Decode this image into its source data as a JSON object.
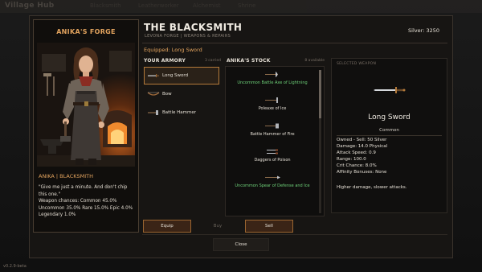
{
  "topbar": {
    "title": "Village Hub",
    "nav": [
      "Blacksmith",
      "Leatherworker",
      "Alchemist",
      "Shrine"
    ]
  },
  "version": "v0.2.9-beta",
  "forge": {
    "title": "ANIKA'S FORGE",
    "character": "ANIKA | BLACKSMITH",
    "quote": "\"Give me just a minute. And don't chip this one.\"",
    "chances_line1": "Weapon chances: Common 45.0%",
    "chances_line2": "Uncommon 35.0%  Rare 15.0%  Epic 4.0%",
    "chances_line3": "Legendary 1.0%"
  },
  "header": {
    "title": "THE BLACKSMITH",
    "subtitle": "LEVONA FORGE  |  WEAPONS & REPAIRS",
    "silver": "Silver: 3250",
    "equipped": "Equipped: Long Sword"
  },
  "armory": {
    "title": "YOUR ARMORY",
    "count": "3 carried",
    "items": [
      {
        "label": "Long Sword",
        "icon": "sword-icon",
        "selected": true
      },
      {
        "label": "Bow",
        "icon": "bow-icon",
        "selected": false
      },
      {
        "label": "Battle Hammer",
        "icon": "hammer-icon",
        "selected": false
      }
    ]
  },
  "stock": {
    "title": "ANIKA'S STOCK",
    "count": "8 available",
    "items": [
      {
        "label": "Uncommon Battle Axe of Lightning",
        "rarity": "uncommon",
        "icon": "axe-icon"
      },
      {
        "label": "Poleaxe of Ice",
        "rarity": "common",
        "icon": "poleaxe-icon"
      },
      {
        "label": "Battle Hammer of Fire",
        "rarity": "common",
        "icon": "hammer-icon"
      },
      {
        "label": "Daggers of Poison",
        "rarity": "common",
        "icon": "daggers-icon"
      },
      {
        "label": "Uncommon Spear of Defense and Ice",
        "rarity": "uncommon",
        "icon": "spear-icon"
      }
    ]
  },
  "detail": {
    "label": "SELECTED WEAPON",
    "name": "Long Sword",
    "rarity": "Common",
    "stats": [
      "Owned - Sell: 50 Silver",
      "Damage: 14.0 Physical",
      "Attack Speed: 0.9",
      "Range: 100.0",
      "Crit Chance: 8.0%",
      "Affinity Bonuses: None"
    ],
    "flavor": "Higher damage, slower attacks."
  },
  "buttons": {
    "equip": "Equip",
    "buy": "Buy",
    "sell": "Sell",
    "close": "Close"
  },
  "colors": {
    "accent": "#e2a35e",
    "uncommon": "#6fd37a",
    "button_bg": "#3a2416",
    "button_border": "#9b6530"
  }
}
